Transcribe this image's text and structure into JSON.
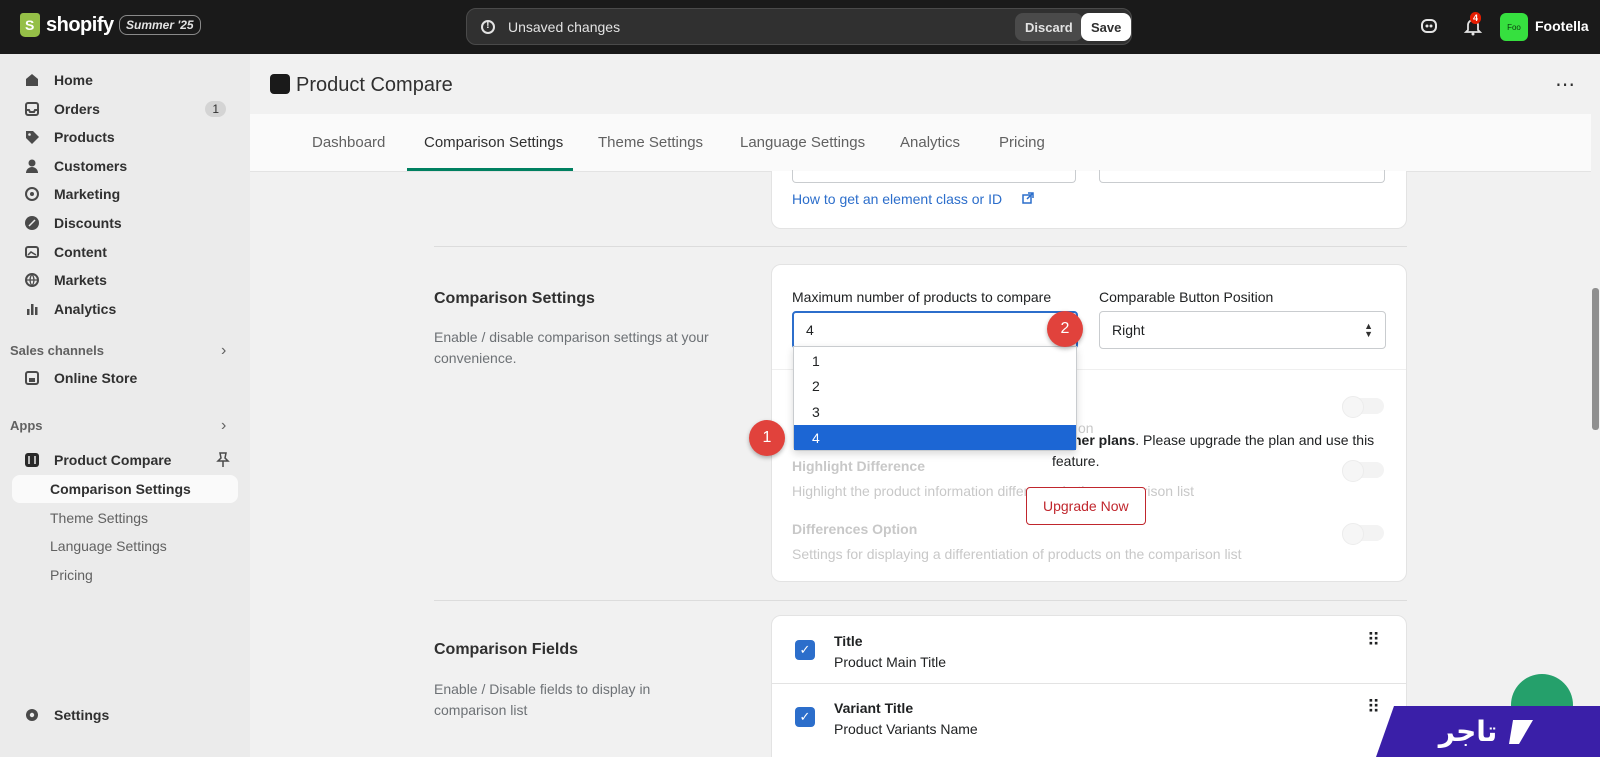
{
  "topbar": {
    "brand": "shopify",
    "edition": "Summer '25",
    "unsaved_message": "Unsaved changes",
    "discard_label": "Discard",
    "save_label": "Save",
    "notification_count": "4",
    "store_avatar_text": "Foo",
    "store_name": "Footella"
  },
  "sidebar": {
    "items": [
      {
        "label": "Home",
        "icon": "home-icon"
      },
      {
        "label": "Orders",
        "icon": "inbox-icon",
        "count": "1"
      },
      {
        "label": "Products",
        "icon": "tag-icon"
      },
      {
        "label": "Customers",
        "icon": "person-icon"
      },
      {
        "label": "Marketing",
        "icon": "target-icon"
      },
      {
        "label": "Discounts",
        "icon": "discount-icon"
      },
      {
        "label": "Content",
        "icon": "image-icon"
      },
      {
        "label": "Markets",
        "icon": "globe-icon"
      },
      {
        "label": "Analytics",
        "icon": "bar-chart-icon"
      }
    ],
    "sales_channels_label": "Sales channels",
    "online_store_label": "Online Store",
    "apps_label": "Apps",
    "app_name": "Product Compare",
    "app_subitems": [
      "Comparison Settings",
      "Theme Settings",
      "Language Settings",
      "Pricing"
    ],
    "settings_label": "Settings"
  },
  "app": {
    "title": "Product Compare",
    "tabs": [
      "Dashboard",
      "Comparison Settings",
      "Theme Settings",
      "Language Settings",
      "Analytics",
      "Pricing"
    ],
    "active_tab": "Comparison Settings"
  },
  "element_help": {
    "link": "How to get an element class or ID"
  },
  "comparison_settings": {
    "title": "Comparison Settings",
    "description": "Enable / disable comparison settings at your convenience.",
    "max_products_label": "Maximum number of products to compare",
    "max_products_value": "4",
    "max_products_options": [
      "1",
      "2",
      "3",
      "4"
    ],
    "button_position_label": "Comparable Button Position",
    "button_position_value": "Right",
    "upgrade_notice_bold": "higher plans",
    "upgrade_notice_text": ". Please upgrade the plan and use this feature.",
    "hidden_fragment": "on",
    "highlight_title": "Highlight Difference",
    "highlight_desc": "Highlight the product information difference in the comparison list",
    "differences_title": "Differences Option",
    "differences_desc": "Settings for displaying a differentiation of products on the comparison list",
    "upgrade_button": "Upgrade Now"
  },
  "markers": [
    "1",
    "2"
  ],
  "comparison_fields": {
    "title": "Comparison Fields",
    "description": "Enable / Disable fields to display in comparison list",
    "rows": [
      {
        "title": "Title",
        "subtitle": "Product Main Title"
      },
      {
        "title": "Variant Title",
        "subtitle": "Product Variants Name"
      }
    ]
  },
  "watermark": {
    "text": "تاجر"
  },
  "colors": {
    "accent": "#2c6ecb",
    "tab_underline": "#008060",
    "upgrade": "#c0262d",
    "marker": "#e1423c",
    "selected_option": "#1c66d4"
  }
}
